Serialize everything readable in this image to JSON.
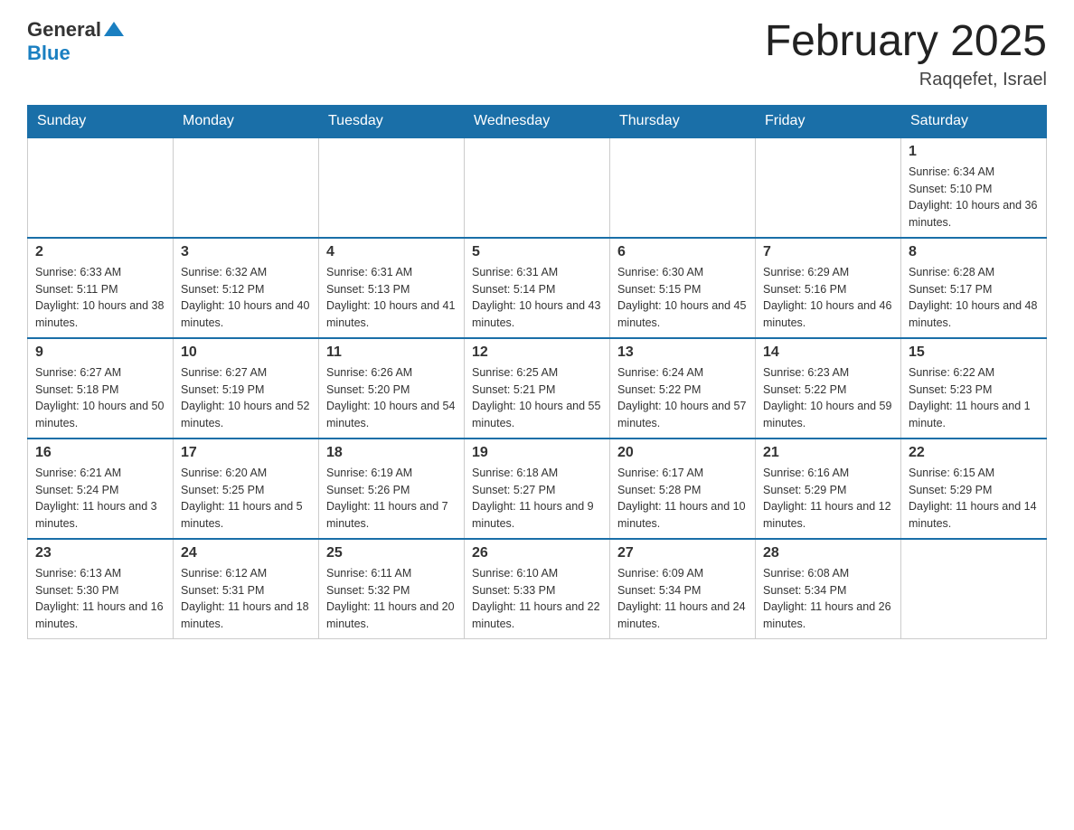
{
  "header": {
    "logo_general": "General",
    "logo_blue": "Blue",
    "title": "February 2025",
    "subtitle": "Raqqefet, Israel"
  },
  "days_of_week": [
    "Sunday",
    "Monday",
    "Tuesday",
    "Wednesday",
    "Thursday",
    "Friday",
    "Saturday"
  ],
  "weeks": [
    [
      {
        "day": "",
        "sunrise": "",
        "sunset": "",
        "daylight": ""
      },
      {
        "day": "",
        "sunrise": "",
        "sunset": "",
        "daylight": ""
      },
      {
        "day": "",
        "sunrise": "",
        "sunset": "",
        "daylight": ""
      },
      {
        "day": "",
        "sunrise": "",
        "sunset": "",
        "daylight": ""
      },
      {
        "day": "",
        "sunrise": "",
        "sunset": "",
        "daylight": ""
      },
      {
        "day": "",
        "sunrise": "",
        "sunset": "",
        "daylight": ""
      },
      {
        "day": "1",
        "sunrise": "Sunrise: 6:34 AM",
        "sunset": "Sunset: 5:10 PM",
        "daylight": "Daylight: 10 hours and 36 minutes."
      }
    ],
    [
      {
        "day": "2",
        "sunrise": "Sunrise: 6:33 AM",
        "sunset": "Sunset: 5:11 PM",
        "daylight": "Daylight: 10 hours and 38 minutes."
      },
      {
        "day": "3",
        "sunrise": "Sunrise: 6:32 AM",
        "sunset": "Sunset: 5:12 PM",
        "daylight": "Daylight: 10 hours and 40 minutes."
      },
      {
        "day": "4",
        "sunrise": "Sunrise: 6:31 AM",
        "sunset": "Sunset: 5:13 PM",
        "daylight": "Daylight: 10 hours and 41 minutes."
      },
      {
        "day": "5",
        "sunrise": "Sunrise: 6:31 AM",
        "sunset": "Sunset: 5:14 PM",
        "daylight": "Daylight: 10 hours and 43 minutes."
      },
      {
        "day": "6",
        "sunrise": "Sunrise: 6:30 AM",
        "sunset": "Sunset: 5:15 PM",
        "daylight": "Daylight: 10 hours and 45 minutes."
      },
      {
        "day": "7",
        "sunrise": "Sunrise: 6:29 AM",
        "sunset": "Sunset: 5:16 PM",
        "daylight": "Daylight: 10 hours and 46 minutes."
      },
      {
        "day": "8",
        "sunrise": "Sunrise: 6:28 AM",
        "sunset": "Sunset: 5:17 PM",
        "daylight": "Daylight: 10 hours and 48 minutes."
      }
    ],
    [
      {
        "day": "9",
        "sunrise": "Sunrise: 6:27 AM",
        "sunset": "Sunset: 5:18 PM",
        "daylight": "Daylight: 10 hours and 50 minutes."
      },
      {
        "day": "10",
        "sunrise": "Sunrise: 6:27 AM",
        "sunset": "Sunset: 5:19 PM",
        "daylight": "Daylight: 10 hours and 52 minutes."
      },
      {
        "day": "11",
        "sunrise": "Sunrise: 6:26 AM",
        "sunset": "Sunset: 5:20 PM",
        "daylight": "Daylight: 10 hours and 54 minutes."
      },
      {
        "day": "12",
        "sunrise": "Sunrise: 6:25 AM",
        "sunset": "Sunset: 5:21 PM",
        "daylight": "Daylight: 10 hours and 55 minutes."
      },
      {
        "day": "13",
        "sunrise": "Sunrise: 6:24 AM",
        "sunset": "Sunset: 5:22 PM",
        "daylight": "Daylight: 10 hours and 57 minutes."
      },
      {
        "day": "14",
        "sunrise": "Sunrise: 6:23 AM",
        "sunset": "Sunset: 5:22 PM",
        "daylight": "Daylight: 10 hours and 59 minutes."
      },
      {
        "day": "15",
        "sunrise": "Sunrise: 6:22 AM",
        "sunset": "Sunset: 5:23 PM",
        "daylight": "Daylight: 11 hours and 1 minute."
      }
    ],
    [
      {
        "day": "16",
        "sunrise": "Sunrise: 6:21 AM",
        "sunset": "Sunset: 5:24 PM",
        "daylight": "Daylight: 11 hours and 3 minutes."
      },
      {
        "day": "17",
        "sunrise": "Sunrise: 6:20 AM",
        "sunset": "Sunset: 5:25 PM",
        "daylight": "Daylight: 11 hours and 5 minutes."
      },
      {
        "day": "18",
        "sunrise": "Sunrise: 6:19 AM",
        "sunset": "Sunset: 5:26 PM",
        "daylight": "Daylight: 11 hours and 7 minutes."
      },
      {
        "day": "19",
        "sunrise": "Sunrise: 6:18 AM",
        "sunset": "Sunset: 5:27 PM",
        "daylight": "Daylight: 11 hours and 9 minutes."
      },
      {
        "day": "20",
        "sunrise": "Sunrise: 6:17 AM",
        "sunset": "Sunset: 5:28 PM",
        "daylight": "Daylight: 11 hours and 10 minutes."
      },
      {
        "day": "21",
        "sunrise": "Sunrise: 6:16 AM",
        "sunset": "Sunset: 5:29 PM",
        "daylight": "Daylight: 11 hours and 12 minutes."
      },
      {
        "day": "22",
        "sunrise": "Sunrise: 6:15 AM",
        "sunset": "Sunset: 5:29 PM",
        "daylight": "Daylight: 11 hours and 14 minutes."
      }
    ],
    [
      {
        "day": "23",
        "sunrise": "Sunrise: 6:13 AM",
        "sunset": "Sunset: 5:30 PM",
        "daylight": "Daylight: 11 hours and 16 minutes."
      },
      {
        "day": "24",
        "sunrise": "Sunrise: 6:12 AM",
        "sunset": "Sunset: 5:31 PM",
        "daylight": "Daylight: 11 hours and 18 minutes."
      },
      {
        "day": "25",
        "sunrise": "Sunrise: 6:11 AM",
        "sunset": "Sunset: 5:32 PM",
        "daylight": "Daylight: 11 hours and 20 minutes."
      },
      {
        "day": "26",
        "sunrise": "Sunrise: 6:10 AM",
        "sunset": "Sunset: 5:33 PM",
        "daylight": "Daylight: 11 hours and 22 minutes."
      },
      {
        "day": "27",
        "sunrise": "Sunrise: 6:09 AM",
        "sunset": "Sunset: 5:34 PM",
        "daylight": "Daylight: 11 hours and 24 minutes."
      },
      {
        "day": "28",
        "sunrise": "Sunrise: 6:08 AM",
        "sunset": "Sunset: 5:34 PM",
        "daylight": "Daylight: 11 hours and 26 minutes."
      },
      {
        "day": "",
        "sunrise": "",
        "sunset": "",
        "daylight": ""
      }
    ]
  ]
}
